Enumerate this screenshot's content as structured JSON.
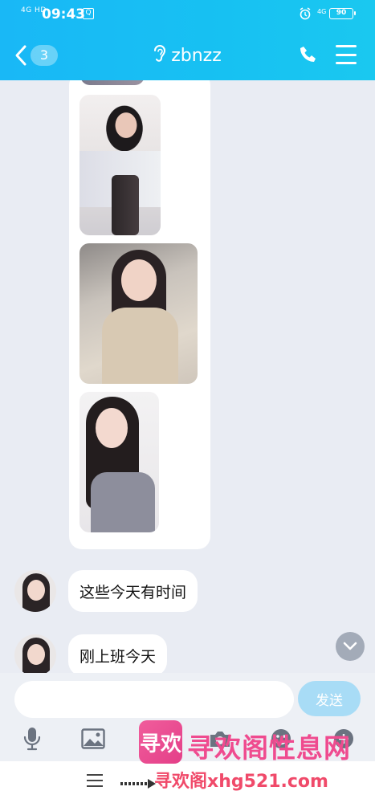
{
  "status_bar": {
    "signal": "4G HD",
    "time": "09:43",
    "network": "4G",
    "battery": "90"
  },
  "header": {
    "unread_count": "3",
    "contact_name": "zbnzz"
  },
  "messages": [
    {
      "text": "这些今天有时间"
    },
    {
      "text": "刚上班今天"
    }
  ],
  "input": {
    "value": "",
    "placeholder": "",
    "send_label": "发送"
  },
  "watermark": {
    "logo_text": "寻欢",
    "site_name": "寻欢阁性息网",
    "site_url": "寻欢阁xhg521.com"
  },
  "colors": {
    "header_start": "#19b8f6",
    "header_end": "#1ac8f0",
    "chat_bg": "#e9ecf3",
    "send_button": "#a8dcf6"
  }
}
